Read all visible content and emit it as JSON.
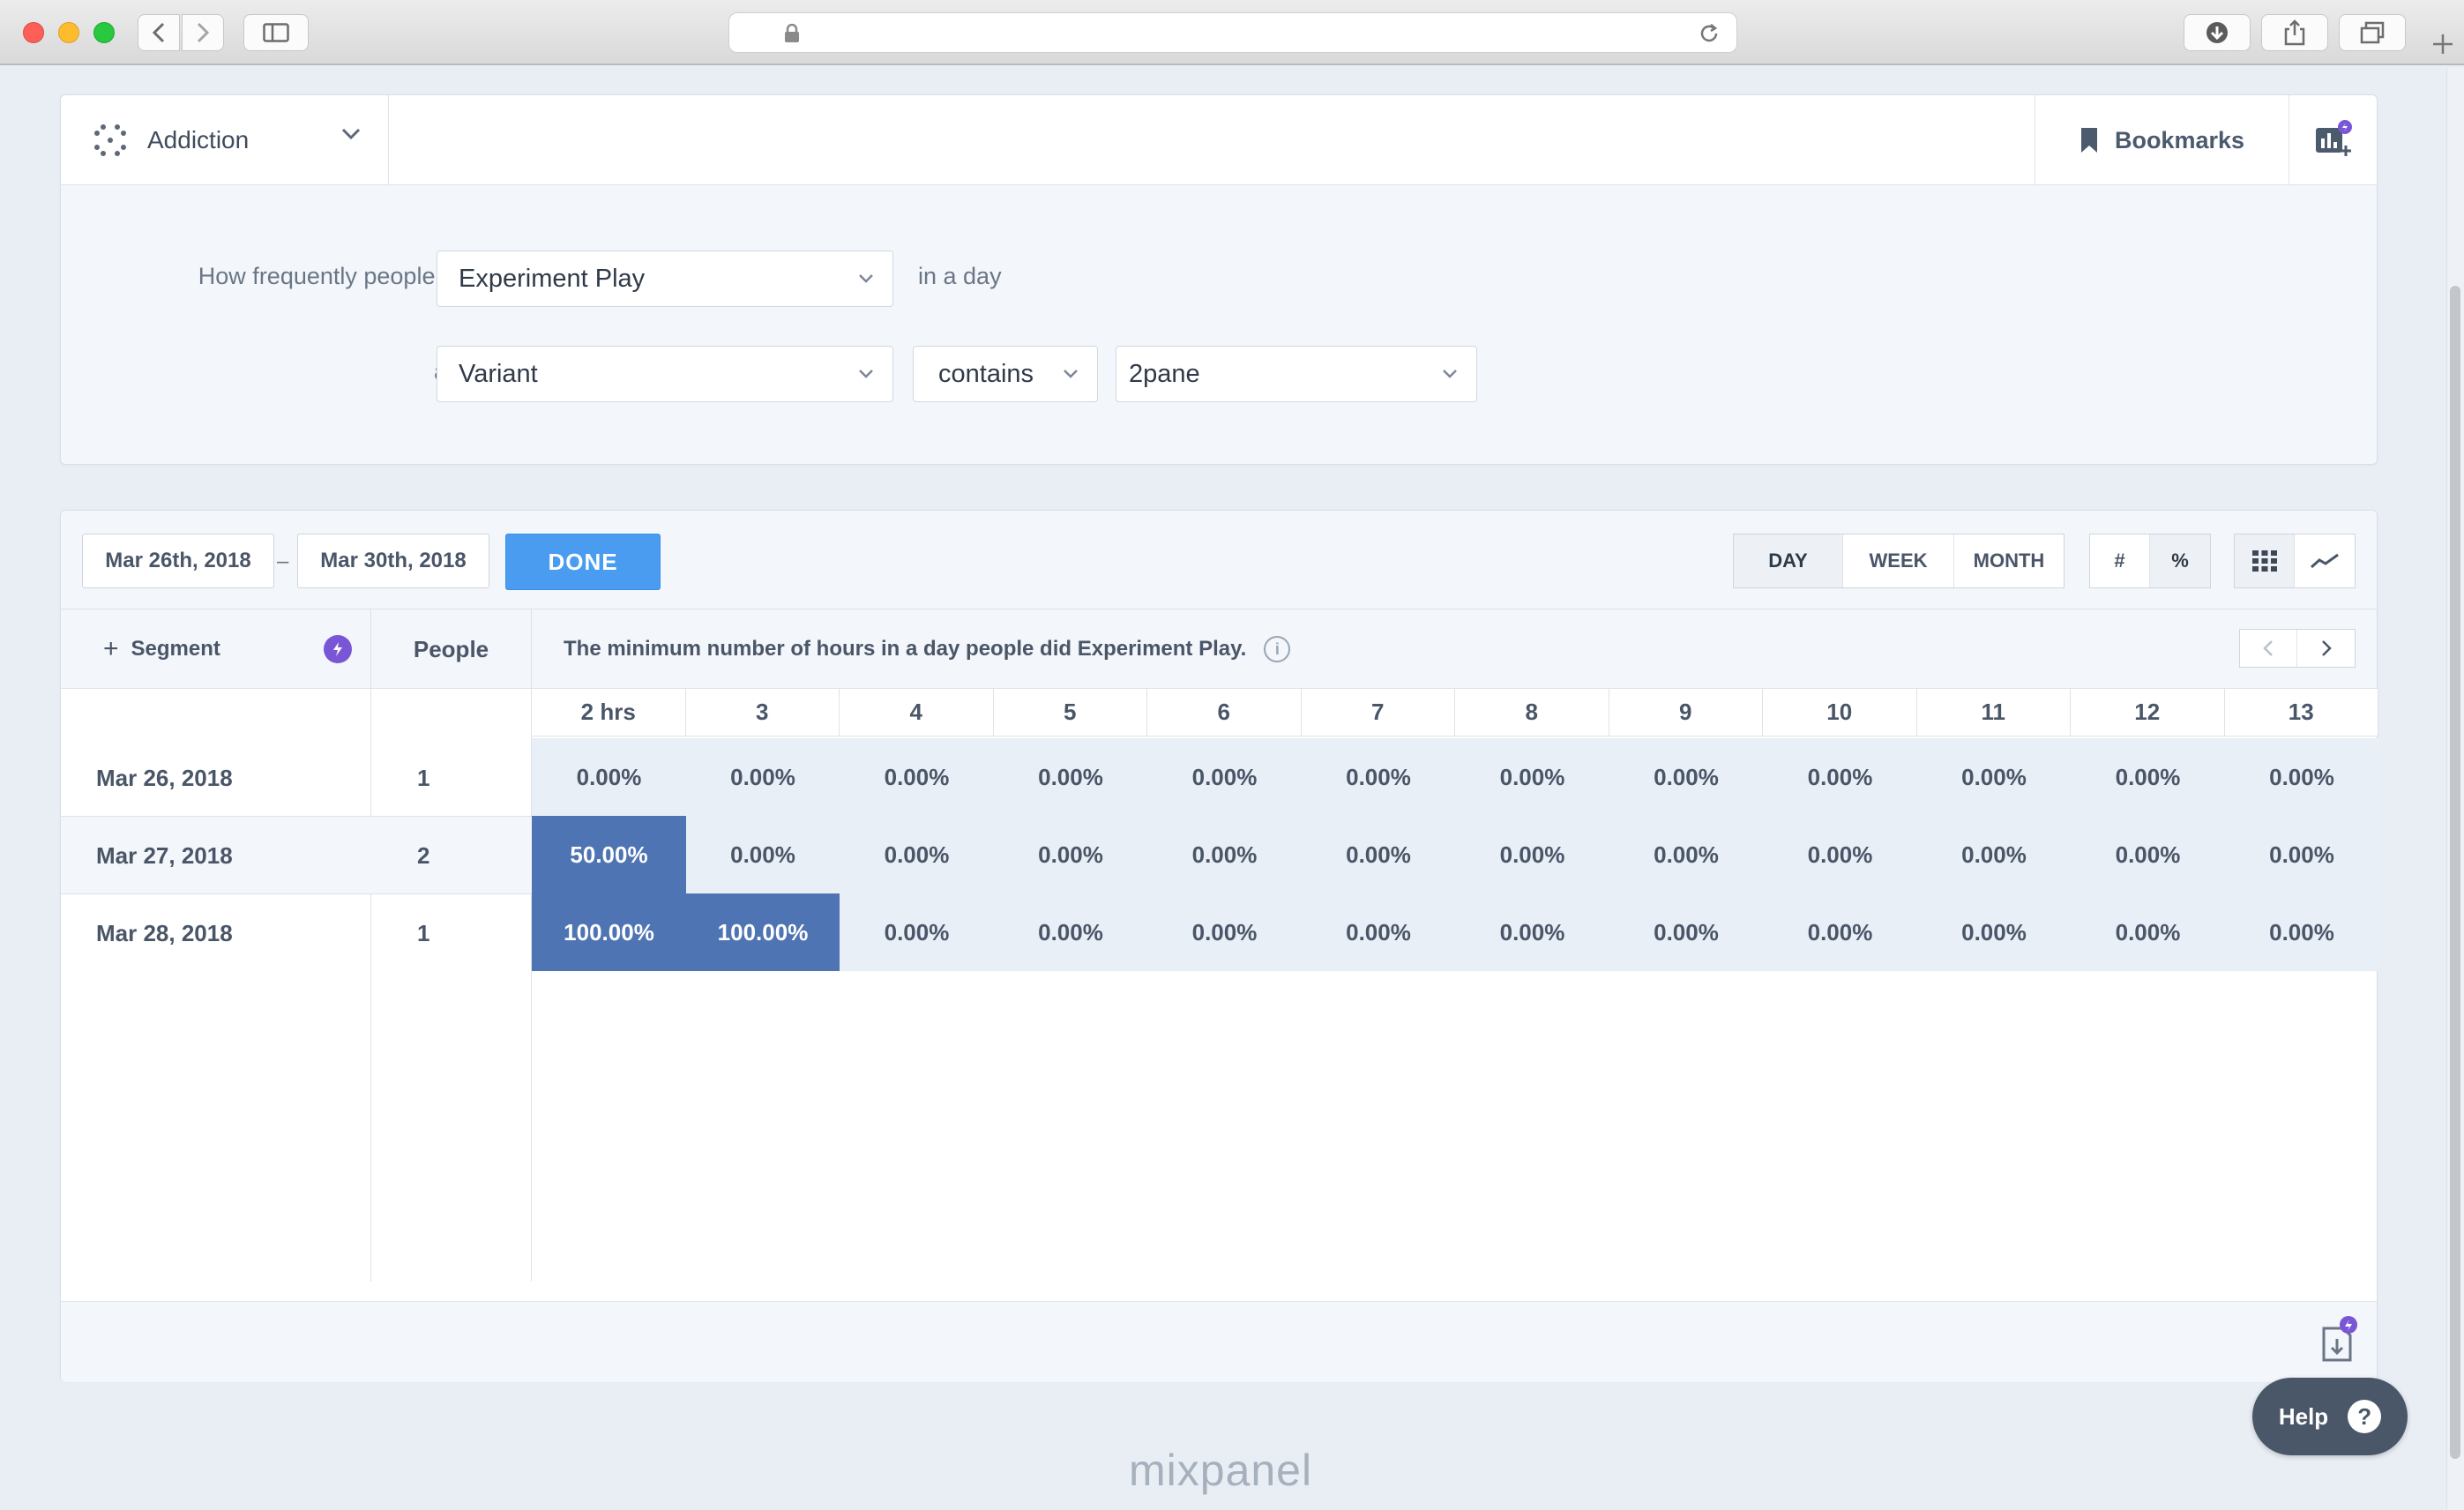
{
  "report": {
    "name": "Addiction"
  },
  "header": {
    "bookmarks_label": "Bookmarks"
  },
  "query": {
    "prefix": "How frequently people did",
    "event": "Experiment Play",
    "suffix": "in a day",
    "and_label": "and",
    "property": "Variant",
    "operator": "contains",
    "value": "2pane"
  },
  "toolbar": {
    "date_from": "Mar 26th, 2018",
    "date_sep": "–",
    "date_to": "Mar 30th, 2018",
    "done_label": "DONE",
    "granularity": [
      "DAY",
      "WEEK",
      "MONTH"
    ],
    "selected_granularity": "DAY",
    "unit_number": "#",
    "unit_percent": "%"
  },
  "grid": {
    "segment_label": "Segment",
    "people_label": "People",
    "description": "The minimum number of hours in a day people did Experiment Play.",
    "info_glyph": "i",
    "buckets": [
      "2 hrs",
      "3",
      "4",
      "5",
      "6",
      "7",
      "8",
      "9",
      "10",
      "11",
      "12",
      "13"
    ],
    "rows": [
      {
        "date": "Mar 26, 2018",
        "people": "1",
        "values": [
          "0.00%",
          "0.00%",
          "0.00%",
          "0.00%",
          "0.00%",
          "0.00%",
          "0.00%",
          "0.00%",
          "0.00%",
          "0.00%",
          "0.00%",
          "0.00%"
        ],
        "hot": [
          false,
          false,
          false,
          false,
          false,
          false,
          false,
          false,
          false,
          false,
          false,
          false
        ]
      },
      {
        "date": "Mar 27, 2018",
        "people": "2",
        "values": [
          "50.00%",
          "0.00%",
          "0.00%",
          "0.00%",
          "0.00%",
          "0.00%",
          "0.00%",
          "0.00%",
          "0.00%",
          "0.00%",
          "0.00%",
          "0.00%"
        ],
        "hot": [
          true,
          false,
          false,
          false,
          false,
          false,
          false,
          false,
          false,
          false,
          false,
          false
        ]
      },
      {
        "date": "Mar 28, 2018",
        "people": "1",
        "values": [
          "100.00%",
          "100.00%",
          "0.00%",
          "0.00%",
          "0.00%",
          "0.00%",
          "0.00%",
          "0.00%",
          "0.00%",
          "0.00%",
          "0.00%",
          "0.00%"
        ],
        "hot": [
          true,
          true,
          false,
          false,
          false,
          false,
          false,
          false,
          false,
          false,
          false,
          false
        ]
      }
    ]
  },
  "help": {
    "label": "Help",
    "glyph": "?"
  },
  "brand": {
    "name": "mixpanel"
  },
  "colors": {
    "accent": "#4a9cf0",
    "heat": "#4f74b3",
    "badge": "#7856d6",
    "help_bg": "#4a5768"
  }
}
